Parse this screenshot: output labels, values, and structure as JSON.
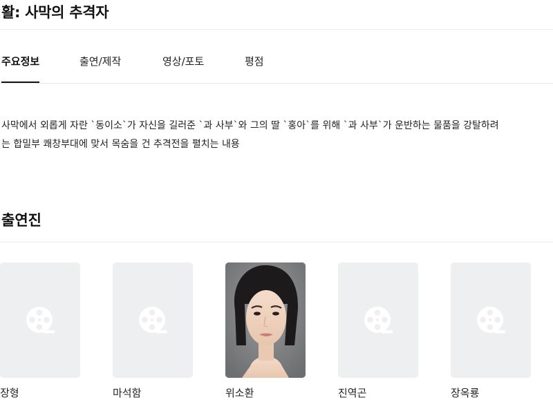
{
  "page": {
    "title": "활: 사막의 추격자"
  },
  "tabs": [
    {
      "label": "주요정보",
      "active": true
    },
    {
      "label": "출연/제작",
      "active": false
    },
    {
      "label": "영상/포토",
      "active": false
    },
    {
      "label": "평점",
      "active": false
    }
  ],
  "synopsis": {
    "line1": "사막에서 외롭게 자란 `동이소`가 자신을 길러준 `과 사부`와 그의 딸 `홍아`를 위해 `과 사부`가 운반하는 물품을 강탈하려",
    "line2": "는 합밀부 쾌창부대에 맞서 목숨을 건 추격전을 펼치는 내용"
  },
  "cast": {
    "heading": "출연진",
    "members": [
      {
        "name": "장형",
        "photo": "placeholder-film-reel-icon"
      },
      {
        "name": "마석함",
        "photo": "placeholder-film-reel-icon"
      },
      {
        "name": "위소환",
        "photo": "actor-portrait"
      },
      {
        "name": "진역곤",
        "photo": "placeholder-film-reel-icon"
      },
      {
        "name": "장옥룡",
        "photo": "placeholder-film-reel-icon"
      }
    ]
  },
  "colors": {
    "placeholder_bg": "#eeeff1",
    "reel_icon": "#ffffff",
    "active_tab_underline": "#111111"
  }
}
